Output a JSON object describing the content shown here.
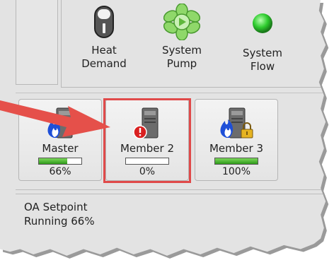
{
  "status_indicators": [
    {
      "label_line1": "Heat",
      "label_line2": "Demand",
      "icon": "thermostat-switch-icon"
    },
    {
      "label_line1": "System",
      "label_line2": "Pump",
      "icon": "pump-icon"
    },
    {
      "label_line1": "System",
      "label_line2": "Flow",
      "icon": "green-led-icon"
    }
  ],
  "boilers": [
    {
      "name": "Master",
      "percent_label": "66%",
      "fill_fraction": 0.66,
      "icon": "boiler-flame-icon"
    },
    {
      "name": "Member 2",
      "percent_label": "0%",
      "fill_fraction": 0.0,
      "icon": "boiler-alert-icon"
    },
    {
      "name": "Member 3",
      "percent_label": "100%",
      "fill_fraction": 1.0,
      "icon": "boiler-flame-locked-icon"
    }
  ],
  "status_text": {
    "line1": "OA Setpoint",
    "line2": "Running 66%"
  },
  "colors": {
    "highlight": "#e04a4a",
    "arrow": "#e5504a",
    "progress_green": "#3aa324",
    "led_green": "#2ecc2e"
  }
}
